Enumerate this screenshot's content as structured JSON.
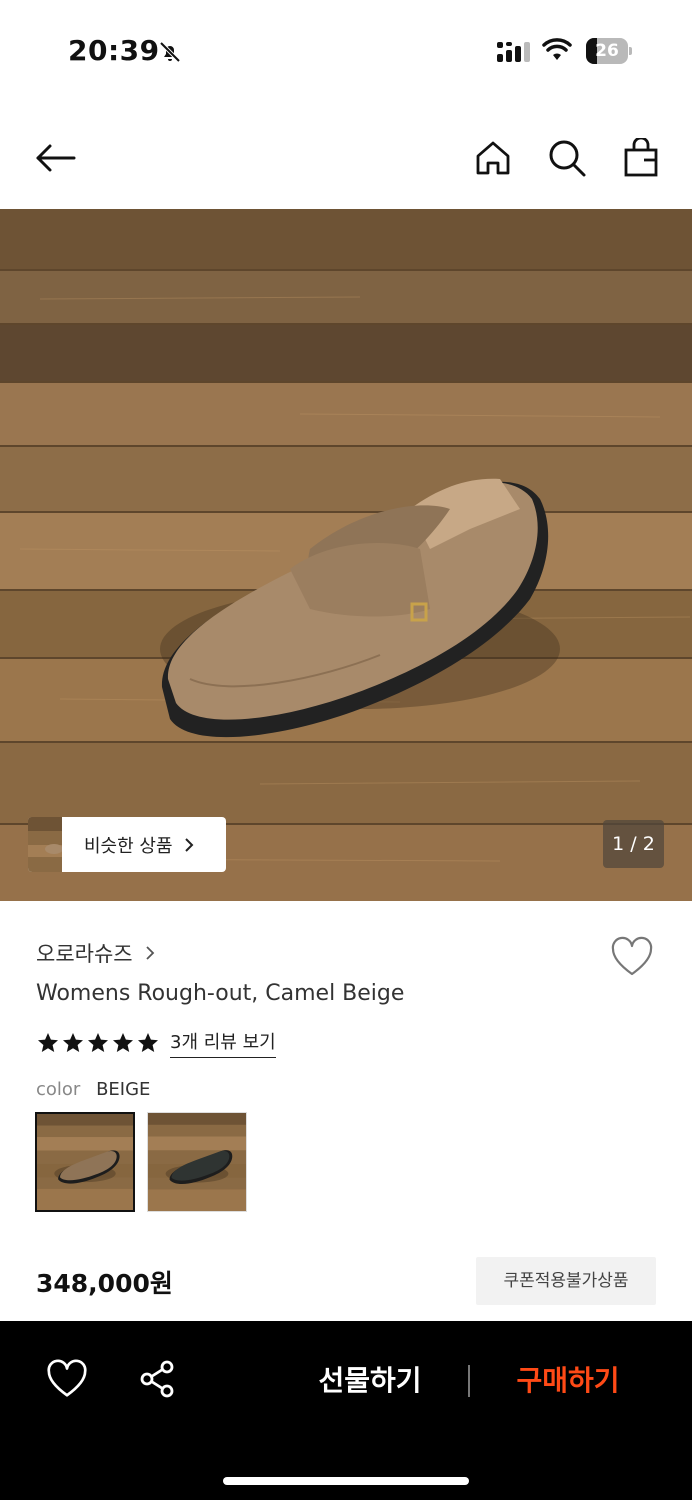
{
  "status_bar": {
    "time": "20:39",
    "battery_level": 26,
    "battery_text": "26",
    "icons": [
      "bell-slash-icon",
      "cellular-signal-icon",
      "wifi-icon",
      "battery-icon"
    ]
  },
  "nav": {
    "icons": [
      "back-arrow-icon",
      "home-icon",
      "search-icon",
      "shopping-bag-icon"
    ]
  },
  "gallery": {
    "similar_label": "비슷한 상품",
    "page_indicator": "1 / 2"
  },
  "product": {
    "brand": "오로라슈즈",
    "title": "Womens Rough-out, Camel Beige",
    "rating_stars": 5,
    "review_link": "3개 리뷰 보기",
    "color_label": "color",
    "color_value": "BEIGE",
    "swatches": [
      {
        "name": "BEIGE",
        "selected": true,
        "shoe_color": "#8f7457"
      },
      {
        "name": "dark",
        "selected": false,
        "shoe_color": "#2f3432"
      }
    ],
    "price": "348,000원",
    "coupon_badge": "쿠폰적용불가상품"
  },
  "bottom_bar": {
    "gift_label": "선물하기",
    "buy_label": "구매하기",
    "icons": [
      "heart-outline-icon",
      "share-icon"
    ]
  },
  "colors": {
    "buy_accent": "#ff4a16",
    "bottom_bar_bg": "#000000",
    "coupon_bg": "#f2f2f2"
  }
}
